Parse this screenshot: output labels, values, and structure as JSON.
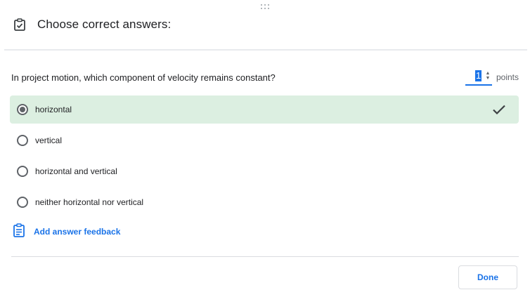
{
  "header": {
    "title": "Choose correct answers:"
  },
  "question": {
    "text": "In project motion, which component of velocity remains constant?",
    "points_value": "1",
    "points_label": "points"
  },
  "options": [
    {
      "label": "horizontal",
      "selected": true,
      "correct": true
    },
    {
      "label": "vertical",
      "selected": false,
      "correct": false
    },
    {
      "label": "horizontal and vertical",
      "selected": false,
      "correct": false
    },
    {
      "label": "neither horizontal nor vertical",
      "selected": false,
      "correct": false
    }
  ],
  "feedback": {
    "label": "Add answer feedback"
  },
  "footer": {
    "done_label": "Done"
  },
  "colors": {
    "accent": "#1a73e8",
    "correct_bg": "#dcefe1"
  },
  "icons": {
    "header": "assignment-check-icon",
    "feedback": "feedback-clipboard-icon",
    "correct": "checkmark-icon",
    "drag": "drag-handle-icon"
  }
}
